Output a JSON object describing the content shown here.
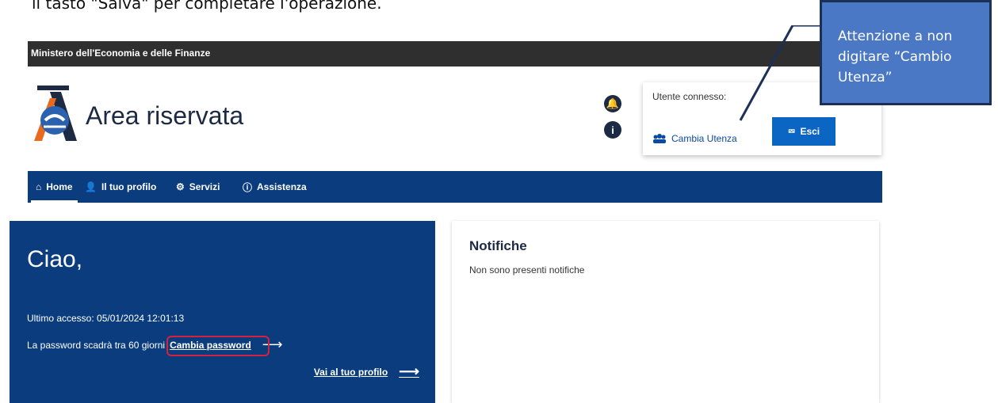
{
  "document": {
    "caption_text": "il tasto \"Salva\" per completare l'operazione."
  },
  "topbar": {
    "title": "Ministero dell'Economia e delle Finanze"
  },
  "header": {
    "app_title": "Area riservata",
    "user_label": "Utente connesso:",
    "switch_user_label": "Cambia Utenza",
    "logout_label": "Esci"
  },
  "nav": {
    "items": [
      {
        "label": "Home",
        "icon": "home-icon"
      },
      {
        "label": "Il tuo profilo",
        "icon": "user-icon"
      },
      {
        "label": "Servizi",
        "icon": "services-icon"
      },
      {
        "label": "Assistenza",
        "icon": "info-icon"
      }
    ]
  },
  "welcome": {
    "greeting": "Ciao,",
    "last_access": "Ultimo accesso: 05/01/2024 12:01:13",
    "password_expiry": "La password scadrà tra 60 giorni",
    "change_password": "Cambia password",
    "profile_link": "Vai al tuo profilo"
  },
  "notifications": {
    "title": "Notifiche",
    "empty_message": "Non sono presenti notifiche"
  },
  "callout": {
    "text": "Attenzione a non digitare “Cambio Utenza”"
  },
  "colors": {
    "primary_blue": "#0b3d7e",
    "button_blue": "#0b66c3",
    "callout_blue": "#4a78c4",
    "highlight_red": "#d4213d"
  }
}
